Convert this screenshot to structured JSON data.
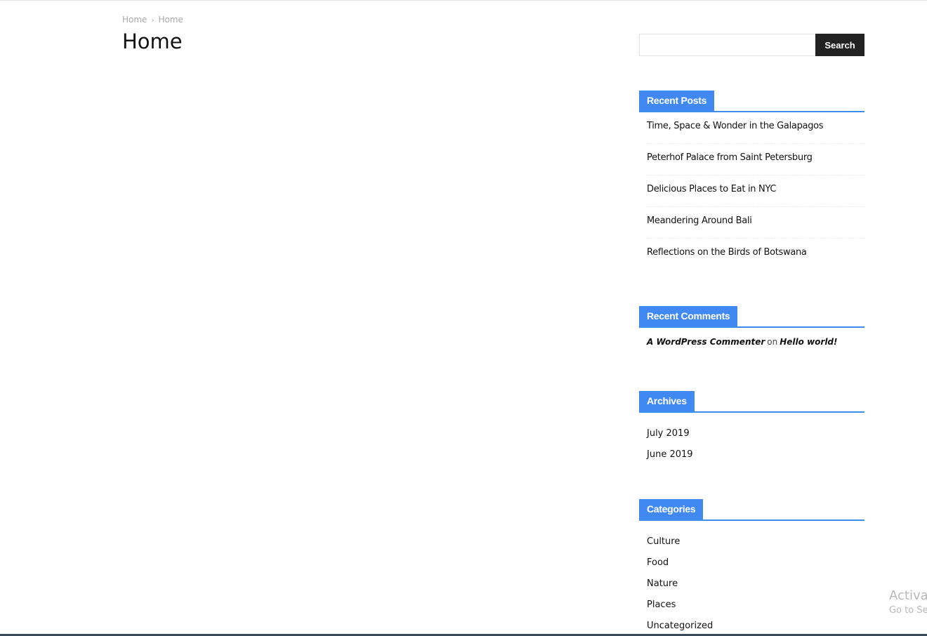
{
  "breadcrumb": {
    "items": [
      "Home",
      "Home"
    ],
    "separator": "›"
  },
  "page": {
    "title": "Home"
  },
  "search": {
    "placeholder": "",
    "value": "",
    "button_label": "Search"
  },
  "recent_posts": {
    "title": "Recent Posts",
    "items": [
      "Time, Space & Wonder in the Galapagos",
      "Peterhof Palace from Saint Petersburg",
      "Delicious Places to Eat in NYC",
      "Meandering Around Bali",
      "Reflections on the Birds of Botswana"
    ]
  },
  "recent_comments": {
    "title": "Recent Comments",
    "items": [
      {
        "author": "A WordPress Commenter",
        "connector": "on",
        "post": "Hello world!"
      }
    ]
  },
  "archives": {
    "title": "Archives",
    "items": [
      "July 2019",
      "June 2019"
    ]
  },
  "categories": {
    "title": "Categories",
    "items": [
      "Culture",
      "Food",
      "Nature",
      "Places",
      "Uncategorized"
    ]
  },
  "watermark": {
    "title": "Activa",
    "subtitle": "Go to Se"
  },
  "colors": {
    "accent": "#4189f2",
    "button_bg": "#222222",
    "text": "#111111",
    "muted": "#a9a9a9"
  }
}
